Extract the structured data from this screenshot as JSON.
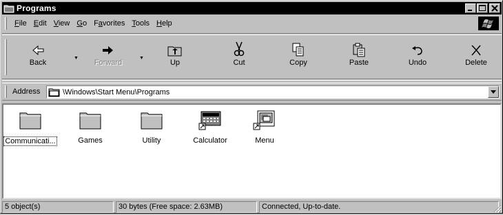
{
  "window": {
    "title": "Programs",
    "controls": [
      "_",
      "□",
      "×"
    ]
  },
  "menubar": {
    "items": [
      {
        "label": "File",
        "accel": "F",
        "rest": "ile"
      },
      {
        "label": "Edit",
        "accel": "E",
        "rest": "dit"
      },
      {
        "label": "View",
        "accel": "V",
        "rest": "iew"
      },
      {
        "label": "Go",
        "accel": "G",
        "rest": "o"
      },
      {
        "label": "Favorites",
        "pre": "F",
        "accel": "a",
        "rest": "vorites"
      },
      {
        "label": "Tools",
        "accel": "T",
        "rest": "ools"
      },
      {
        "label": "Help",
        "accel": "H",
        "rest": "elp"
      }
    ]
  },
  "toolbar": {
    "back": "Back",
    "forward": "Forward",
    "up": "Up",
    "cut": "Cut",
    "copy": "Copy",
    "paste": "Paste",
    "undo": "Undo",
    "delete": "Delete"
  },
  "address": {
    "label": "Address",
    "value": "\\Windows\\Start Menu\\Programs"
  },
  "items": [
    {
      "name": "Communicati...",
      "icon": "folder-icon",
      "focused": true
    },
    {
      "name": "Games",
      "icon": "folder-icon"
    },
    {
      "name": "Utility",
      "icon": "folder-icon"
    },
    {
      "name": "Calculator",
      "icon": "calculator-shortcut-icon"
    },
    {
      "name": "Menu",
      "icon": "menu-shortcut-icon"
    }
  ],
  "statusbar": {
    "objects": "5 object(s)",
    "size": "30 bytes (Free space: 2.63MB)",
    "connection": "Connected, Up-to-date."
  },
  "colors": {
    "titlebar": "#000000",
    "chrome": "#c0c0c0",
    "content_bg": "#ffffff"
  }
}
